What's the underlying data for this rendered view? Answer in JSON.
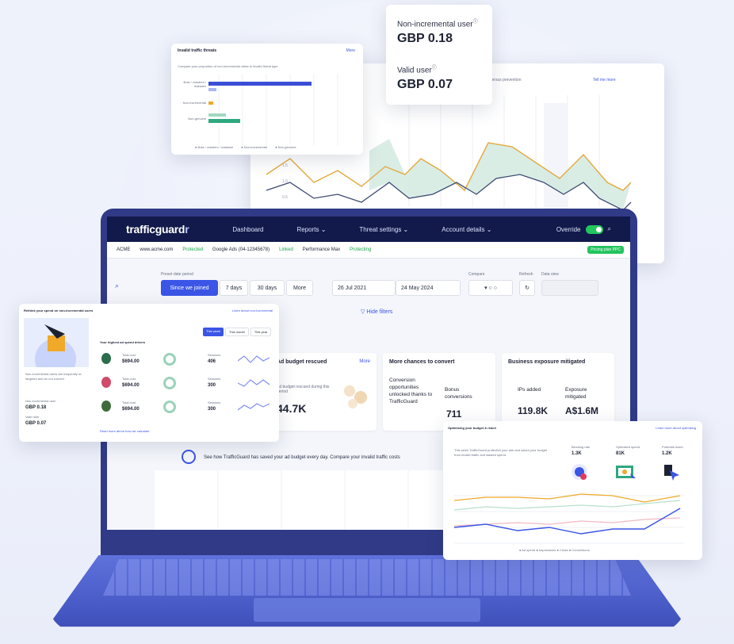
{
  "nav": {
    "logo_main": "trafficguard",
    "logo_mark": "r",
    "items": [
      "Dashboard",
      "Reports ⌄",
      "Threat settings ⌄",
      "Account details ⌄"
    ],
    "override_label": "Override"
  },
  "subbar": {
    "account": "ACME",
    "site": "www.acme.com",
    "site_status": "Protected",
    "ads": "Google Ads (04-12345678)",
    "ads_status": "Linked",
    "campaign": "Performance Max",
    "campaign_status": "Protecting",
    "badge": "Pricing plan PPC"
  },
  "filters": {
    "period_label": "Preset date period",
    "period_buttons": [
      "Since we joined",
      "7 days",
      "30 days",
      "More"
    ],
    "date_from": "26 Jul 2021",
    "date_to": "24 May 2024",
    "compare_label": "Compare",
    "refresh_label": "Refresh",
    "data_view_label": "Data view",
    "hide_filters": "▽ Hide filters"
  },
  "kpis": {
    "budget_title": "Ad budget rescued",
    "budget_more": "More",
    "budget_sub": "Ad budget rescued during this period",
    "budget_value": "44.7K",
    "conv_title": "More chances to convert",
    "conv_text": "Conversion opportunities unlocked thanks to TrafficGuard",
    "conv_bonus_label": "Bonus conversions",
    "conv_bonus_value": "711",
    "exposure_title": "Business exposure mitigated",
    "ips_label": "IPs added",
    "ips_value": "119.8K",
    "exposure_label": "Exposure mitigated",
    "exposure_value": "A$1.6M"
  },
  "savings_banner": "See how TrafficGuard has saved your ad budget every day. Compare your invalid traffic costs",
  "floating_cost": {
    "non_incr_label": "Non-incremental user",
    "non_incr_value": "GBP 0.18",
    "valid_label": "Valid user",
    "valid_value": "GBP 0.07"
  },
  "invalid_traffic": {
    "title": "Invalid traffic threats",
    "more": "More",
    "subtitle": "Compare your proportion of non-incremental clicks to invalid threat type",
    "rows": [
      "Bots / crawlers / malware",
      "Non-incremental",
      "Non-genuine"
    ],
    "legend": [
      "Bots / crawlers / malware",
      "Non-incremental",
      "Non-genuine"
    ]
  },
  "trend_card": {
    "subtitle": "costs in detection versus prevention",
    "link": "Tell me more"
  },
  "persona_card": {
    "title": "Rethink your spend on non-incremental users",
    "link": "Learn about non-incremental",
    "tabs": [
      "This week",
      "This month",
      "This year"
    ],
    "segments_title": "Your highest ad spend drivers",
    "desc": "Non-incremental users are frequently re-targeted and do not convert",
    "value_caption": "Non-incremental user",
    "value1": "GBP 0.18",
    "value2_caption": "Valid user",
    "value2": "GBP 0.07",
    "rows": [
      {
        "spend": "$694.00",
        "sessions": "406"
      },
      {
        "spend": "$694.00",
        "sessions": "300"
      },
      {
        "spend": "$694.00",
        "sessions": "300"
      }
    ],
    "spend_label": "Total cost",
    "sessions_label": "Sessions",
    "footer_link": "Read more about how we calculate"
  },
  "optimise_card": {
    "title": "Optimising your budget & reach",
    "link": "Learn more about optimising",
    "desc": "This week TrafficGuard protected your ads and saved your budget from invalid traffic and wasted spend.",
    "metrics": [
      {
        "label": "Blocking rate",
        "value": "1.3K"
      },
      {
        "label": "Optimised spend",
        "value": "81K"
      },
      {
        "label": "Potential reach",
        "value": "1.2K"
      }
    ],
    "legend": "● Ad spend  ● Impressions  ● Clicks  ● Conversions"
  },
  "colors": {
    "navy": "#111a4a",
    "primary": "#3b55e6",
    "green": "#22c55e",
    "orange": "#f0a929",
    "teal": "#2ea87f"
  }
}
